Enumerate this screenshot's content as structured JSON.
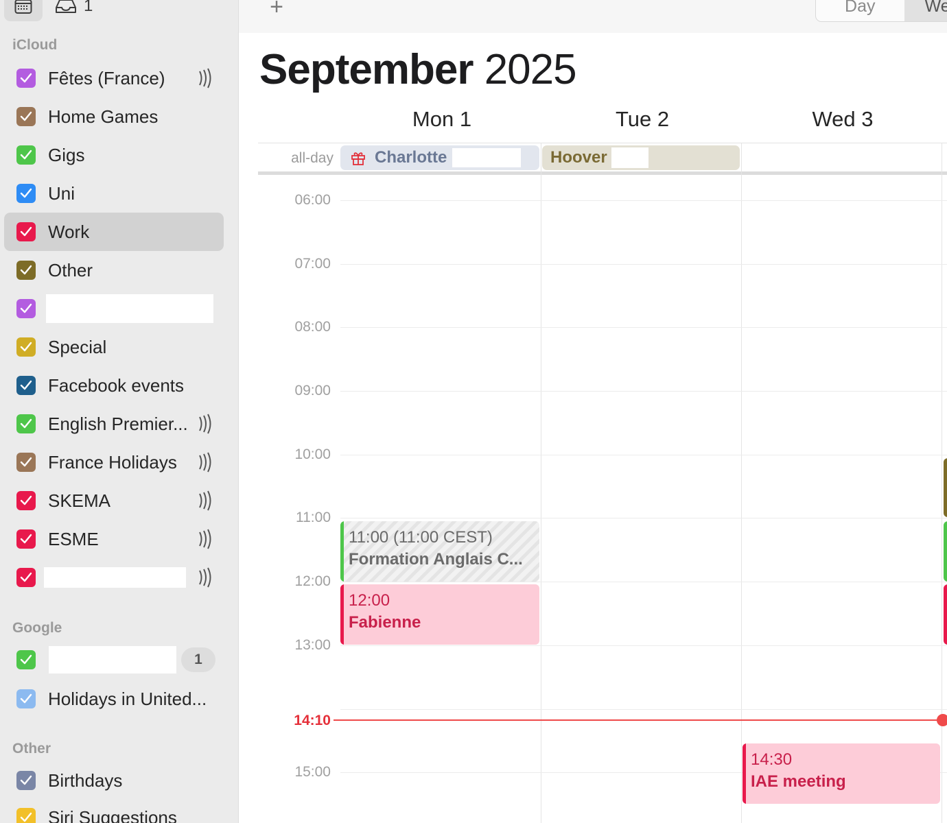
{
  "sidebar": {
    "inbox_count": "1",
    "groups": {
      "icloud": "iCloud",
      "google": "Google",
      "other": "Other"
    },
    "icloud_calendars": [
      {
        "name": "Fêtes (France)",
        "color": "#b35ce0",
        "subscribed": true
      },
      {
        "name": "Home Games",
        "color": "#9a7657",
        "subscribed": false
      },
      {
        "name": "Gigs",
        "color": "#4ec64a",
        "subscribed": false
      },
      {
        "name": "Uni",
        "color": "#2e8cf5",
        "subscribed": false
      },
      {
        "name": "Work",
        "color": "#e8194c",
        "subscribed": false,
        "selected": true
      },
      {
        "name": "Other",
        "color": "#7d6c27",
        "subscribed": false
      },
      {
        "name": "",
        "color": "#b35ce0",
        "subscribed": false
      },
      {
        "name": "Special",
        "color": "#d0ad25",
        "subscribed": false
      },
      {
        "name": "Facebook events",
        "color": "#1f5f8c",
        "subscribed": false
      },
      {
        "name": "English Premier...",
        "color": "#4ec64a",
        "subscribed": true
      },
      {
        "name": "France Holidays",
        "color": "#9a7657",
        "subscribed": true
      },
      {
        "name": "SKEMA",
        "color": "#e8194c",
        "subscribed": true
      },
      {
        "name": "ESME",
        "color": "#e8194c",
        "subscribed": true
      },
      {
        "name": "",
        "color": "#e8194c",
        "subscribed": true
      }
    ],
    "google_calendars": [
      {
        "name": "",
        "color": "#4ec64a",
        "badge": "1"
      },
      {
        "name": "Holidays in United...",
        "color": "#8cbaf0",
        "badge": ""
      }
    ],
    "other_calendars": [
      {
        "name": "Birthdays",
        "color": "#7a86a6"
      },
      {
        "name": "Siri Suggestions",
        "color": "#f2c029"
      }
    ]
  },
  "toolbar": {
    "add_label": "+",
    "view_day": "Day",
    "view_week": "We"
  },
  "header": {
    "month": "September",
    "year": "2025"
  },
  "days": [
    "Mon 1",
    "Tue 2",
    "Wed 3"
  ],
  "allday_label": "all-day",
  "allday_events": [
    {
      "title": "Charlotte",
      "day": 0,
      "icon": "gift-icon"
    },
    {
      "title": "Hoover",
      "day": 1
    }
  ],
  "hours": [
    "06:00",
    "07:00",
    "08:00",
    "09:00",
    "10:00",
    "11:00",
    "12:00",
    "13:00",
    "15:00"
  ],
  "now": "14:10",
  "events": [
    {
      "day": 0,
      "start": "11:00",
      "time_label": "11:00",
      "tz_label": "(11:00 CEST)",
      "title": "Formation Anglais C...",
      "color": "#4ec64a",
      "tentative": true
    },
    {
      "day": 0,
      "start": "12:00",
      "time_label": "12:00",
      "title": "Fabienne",
      "color": "#e8194c"
    },
    {
      "day": 2,
      "start": "14:30",
      "time_label": "14:30",
      "title": "IAE meeting",
      "color": "#e8194c"
    }
  ],
  "colors": {
    "accent_red": "#e5303a",
    "work_red": "#e8194c"
  }
}
